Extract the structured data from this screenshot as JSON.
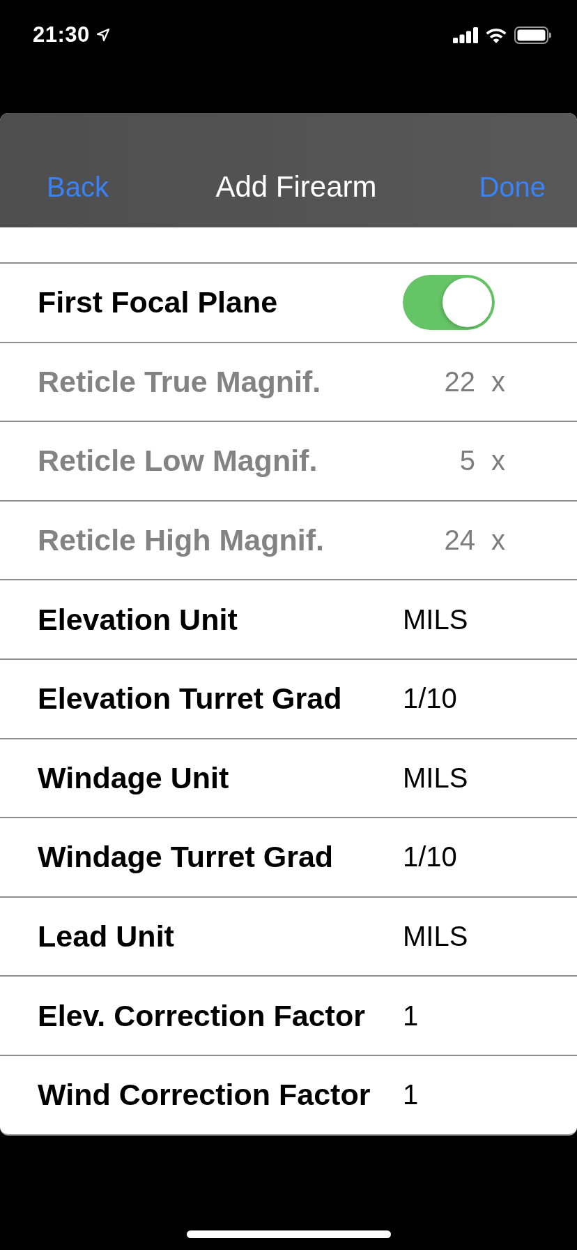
{
  "status_bar": {
    "time": "21:30"
  },
  "nav_bar": {
    "back": "Back",
    "title": "Add Firearm",
    "done": "Done"
  },
  "rows": [
    {
      "kind": "toggle",
      "label": "First Focal Plane",
      "on": true,
      "disabled": false
    },
    {
      "kind": "multiplier",
      "label": "Reticle True Magnif.",
      "value": "22",
      "unit": "x",
      "disabled": true
    },
    {
      "kind": "multiplier",
      "label": "Reticle Low Magnif.",
      "value": "5",
      "unit": "x",
      "disabled": true
    },
    {
      "kind": "multiplier",
      "label": "Reticle High Magnif.",
      "value": "24",
      "unit": "x",
      "disabled": true
    },
    {
      "kind": "value",
      "label": "Elevation Unit",
      "value": "MILS",
      "disabled": false
    },
    {
      "kind": "value",
      "label": "Elevation Turret Grad",
      "value": "1/10",
      "disabled": false
    },
    {
      "kind": "value",
      "label": "Windage Unit",
      "value": "MILS",
      "disabled": false
    },
    {
      "kind": "value",
      "label": "Windage Turret Grad",
      "value": "1/10",
      "disabled": false
    },
    {
      "kind": "value",
      "label": "Lead Unit",
      "value": "MILS",
      "disabled": false
    },
    {
      "kind": "value",
      "label": "Elev. Correction Factor",
      "value": "1",
      "disabled": false
    },
    {
      "kind": "value",
      "label": "Wind Correction Factor",
      "value": "1",
      "disabled": false
    }
  ]
}
